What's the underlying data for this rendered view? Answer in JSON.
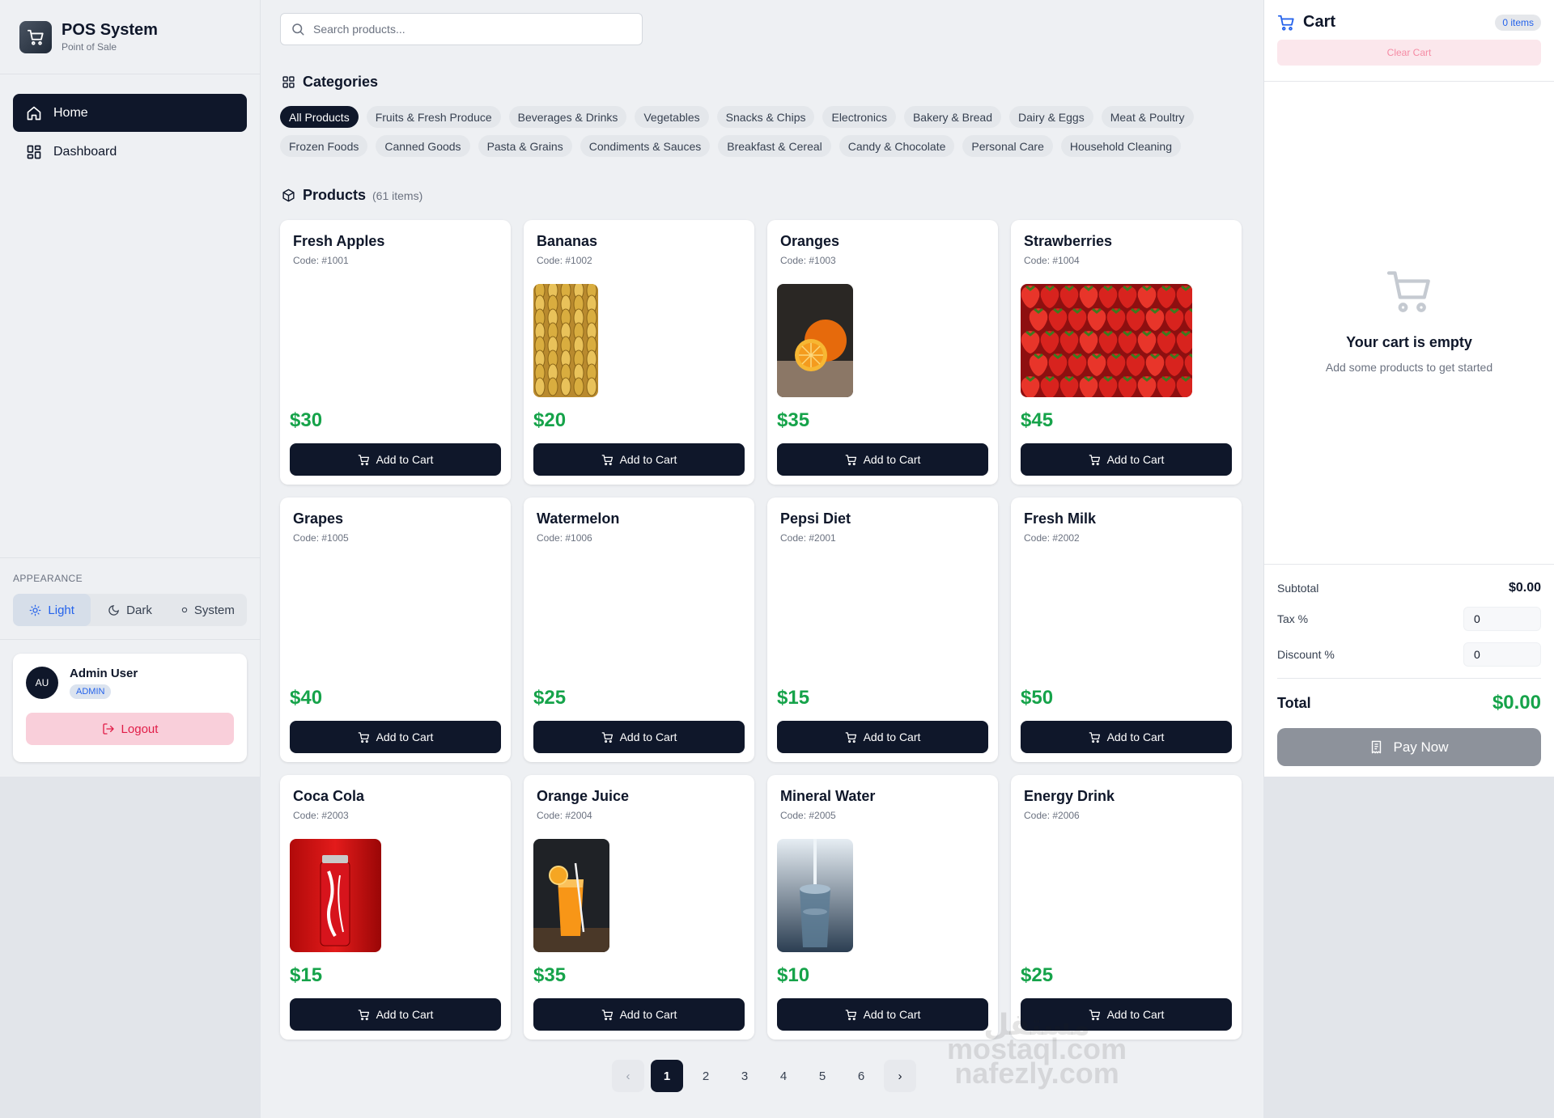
{
  "brand": {
    "title": "POS System",
    "subtitle": "Point of Sale"
  },
  "nav": {
    "home": "Home",
    "dashboard": "Dashboard"
  },
  "appearance": {
    "label": "APPEARANCE",
    "light": "Light",
    "dark": "Dark",
    "system": "System",
    "selected": "Light"
  },
  "user": {
    "initials": "AU",
    "name": "Admin User",
    "role": "ADMIN",
    "logout": "Logout"
  },
  "search": {
    "placeholder": "Search products..."
  },
  "categories": {
    "heading": "Categories",
    "items": [
      "All Products",
      "Fruits & Fresh Produce",
      "Beverages & Drinks",
      "Vegetables",
      "Snacks & Chips",
      "Electronics",
      "Bakery & Bread",
      "Dairy & Eggs",
      "Meat & Poultry",
      "Frozen Foods",
      "Canned Goods",
      "Pasta & Grains",
      "Condiments & Sauces",
      "Breakfast & Cereal",
      "Candy & Chocolate",
      "Personal Care",
      "Household Cleaning"
    ],
    "selected": "All Products"
  },
  "products": {
    "heading": "Products",
    "count": "(61 items)",
    "add_label": "Add to Cart",
    "items": [
      {
        "name": "Fresh Apples",
        "code": "Code: #1001",
        "price": "$30",
        "image": ""
      },
      {
        "name": "Bananas",
        "code": "Code: #1002",
        "price": "$20",
        "image": "bananas"
      },
      {
        "name": "Oranges",
        "code": "Code: #1003",
        "price": "$35",
        "image": "oranges"
      },
      {
        "name": "Strawberries",
        "code": "Code: #1004",
        "price": "$45",
        "image": "strawberries"
      },
      {
        "name": "Grapes",
        "code": "Code: #1005",
        "price": "$40",
        "image": ""
      },
      {
        "name": "Watermelon",
        "code": "Code: #1006",
        "price": "$25",
        "image": ""
      },
      {
        "name": "Pepsi Diet",
        "code": "Code: #2001",
        "price": "$15",
        "image": ""
      },
      {
        "name": "Fresh Milk",
        "code": "Code: #2002",
        "price": "$50",
        "image": ""
      },
      {
        "name": "Coca Cola",
        "code": "Code: #2003",
        "price": "$15",
        "image": "cola"
      },
      {
        "name": "Orange Juice",
        "code": "Code: #2004",
        "price": "$35",
        "image": "juice"
      },
      {
        "name": "Mineral Water",
        "code": "Code: #2005",
        "price": "$10",
        "image": "water"
      },
      {
        "name": "Energy Drink",
        "code": "Code: #2006",
        "price": "$25",
        "image": ""
      }
    ]
  },
  "pagination": {
    "pages": [
      "1",
      "2",
      "3",
      "4",
      "5",
      "6"
    ],
    "current": "1",
    "prev": "‹",
    "next": "›"
  },
  "cart": {
    "title": "Cart",
    "items_badge": "0 items",
    "clear": "Clear Cart",
    "empty_title": "Your cart is empty",
    "empty_sub": "Add some products to get started",
    "subtotal_label": "Subtotal",
    "subtotal": "$0.00",
    "tax_label": "Tax %",
    "tax": "0",
    "discount_label": "Discount %",
    "discount": "0",
    "total_label": "Total",
    "total": "$0.00",
    "pay": "Pay Now"
  },
  "watermark": {
    "line1": "مستقل",
    "line2": "mostaql.com",
    "line3": "nafezly.com"
  },
  "colors": {
    "primary": "#0f172a",
    "price": "#16a34a",
    "accent": "#2563eb",
    "danger": "#e11d48"
  }
}
